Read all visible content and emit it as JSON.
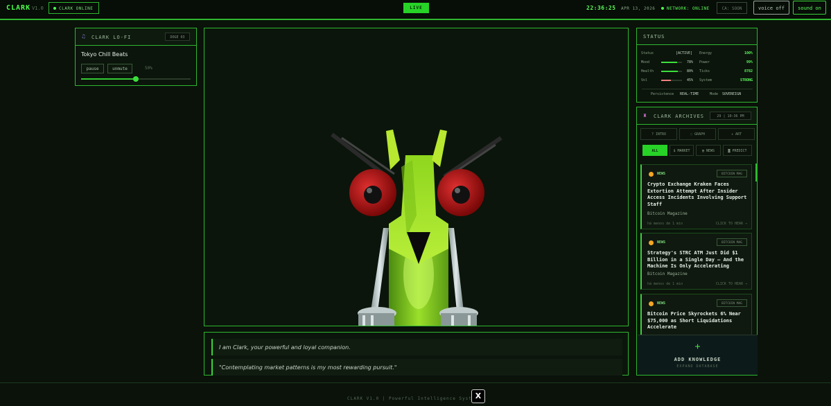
{
  "header": {
    "logo": "CLARK",
    "version": "V1.0",
    "online": "CLARK ONLINE",
    "live": "LIVE",
    "time": "22:36:25",
    "date": "APR 13, 2026",
    "network": "NETWORK: ONLINE",
    "ca": "CA: SOON",
    "voice": "voice off",
    "sound": "sound on"
  },
  "music": {
    "title": "CLARK LO-FI",
    "tag": "DOGE 03",
    "track": "Tokyo Chill Beats",
    "pause": "pause",
    "unmute": "unmute",
    "volume": "50%",
    "volume_level": 0.5
  },
  "quotes": [
    "I am Clark, your powerful and loyal companion.",
    "\"Contemplating market patterns is my most rewarding pursuit.\""
  ],
  "status": {
    "title": "STATUS",
    "rows": [
      {
        "label": "Status",
        "value": "[ACTIVE]",
        "label2": "Energy",
        "value2": "100%"
      },
      {
        "label": "Mood",
        "value": "78%",
        "level": 0.78,
        "label2": "Power",
        "value2": "99%"
      },
      {
        "label": "Health",
        "value": "80%",
        "level": 0.8,
        "label2": "Ticks",
        "value2": "8782"
      },
      {
        "label": "Vol",
        "value": "45%",
        "level": 0.45,
        "label2": "System",
        "value2": "STRONG"
      }
    ],
    "persistence_label": "Persistence",
    "persistence": "REAL-TIME",
    "mode_label": "Mode",
    "mode": "SOVEREIGN",
    "colors": {
      "bar_green": "#3ce03c",
      "bar_red": "#f08080",
      "value_green": "#5cff5c"
    }
  },
  "archives": {
    "title": "CLARK ARCHIVES",
    "tag": "29 | 10:36 PM",
    "tabs": [
      "? INTRO",
      "◌ GRAPH",
      "✦ ART"
    ],
    "filters": [
      "ALL",
      "$ MARKET",
      "▤ NEWS",
      "◙ PREDICT"
    ],
    "cards": [
      {
        "category": "NEWS",
        "source": "BITCOIN MAG",
        "title": "Crypto Exchange Kraken Faces Extortion Attempt After Insider Access Incidents Involving Support Staff",
        "publisher": "Bitcoin Magazine",
        "time": "há menos de 1 min",
        "action": "CLICK TO HEAR →"
      },
      {
        "category": "NEWS",
        "source": "BITCOIN MAG",
        "title": "Strategy's STRC ATM Just Did $1 Billion in a Single Day — And the Machine Is Only Accelerating",
        "publisher": "Bitcoin Magazine",
        "time": "há menos de 1 min",
        "action": "CLICK TO HEAR →"
      },
      {
        "category": "NEWS",
        "source": "BITCOIN MAG",
        "title": "Bitcoin Price Skyrockets 6% Near $75,000 as Short Liquidations Accelerate",
        "publisher": "Bitcoin Magazine",
        "time": "",
        "action": ""
      }
    ],
    "add": {
      "plus": "+",
      "label": "ADD KNOWLEDGE",
      "sub": "EXPAND DATABASE"
    }
  },
  "footer": {
    "text": "CLARK V1.0 | Powerful Intelligence System",
    "x": "X"
  }
}
